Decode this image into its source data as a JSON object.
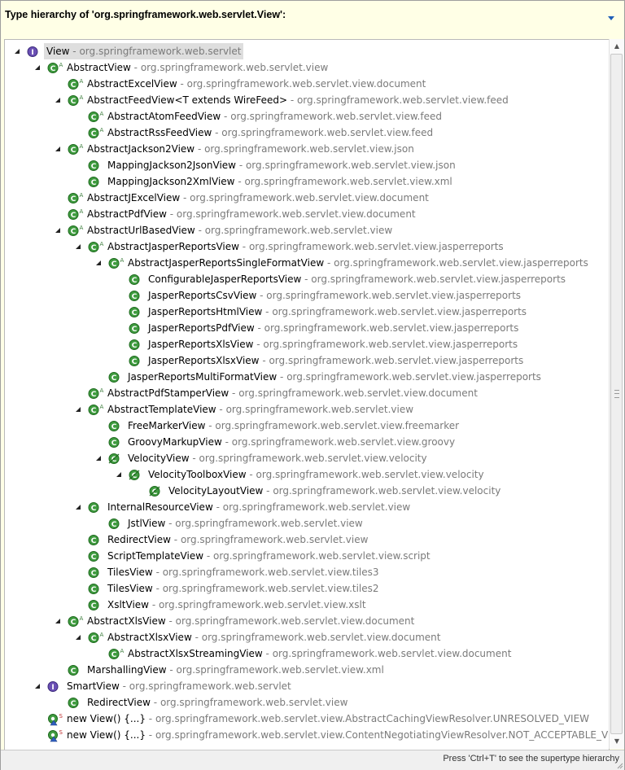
{
  "header": {
    "title": "Type hierarchy of 'org.springframework.web.servlet.View':",
    "menu_icon": "view-menu-chevron-icon"
  },
  "status": {
    "text": "Press 'Ctrl+T' to see the supertype hierarchy"
  },
  "colors": {
    "class_icon": "#3f9b3f",
    "interface_icon": "#6a4fb4",
    "selection": "#dedede",
    "package_text": "#7a7a7a",
    "panel_bg": "#ffffe6"
  },
  "tree": [
    {
      "depth": 0,
      "toggle": "expanded",
      "kind": "interface",
      "name": "View",
      "pkg": "org.springframework.web.servlet",
      "selected": true
    },
    {
      "depth": 1,
      "toggle": "expanded",
      "kind": "class",
      "mod": "A",
      "name": "AbstractView",
      "pkg": "org.springframework.web.servlet.view"
    },
    {
      "depth": 2,
      "toggle": "none",
      "kind": "class",
      "mod": "A",
      "name": "AbstractExcelView",
      "pkg": "org.springframework.web.servlet.view.document"
    },
    {
      "depth": 2,
      "toggle": "expanded",
      "kind": "class",
      "mod": "A",
      "name": "AbstractFeedView<T extends WireFeed>",
      "pkg": "org.springframework.web.servlet.view.feed"
    },
    {
      "depth": 3,
      "toggle": "none",
      "kind": "class",
      "mod": "A",
      "name": "AbstractAtomFeedView",
      "pkg": "org.springframework.web.servlet.view.feed"
    },
    {
      "depth": 3,
      "toggle": "none",
      "kind": "class",
      "mod": "A",
      "name": "AbstractRssFeedView",
      "pkg": "org.springframework.web.servlet.view.feed"
    },
    {
      "depth": 2,
      "toggle": "expanded",
      "kind": "class",
      "mod": "A",
      "name": "AbstractJackson2View",
      "pkg": "org.springframework.web.servlet.view.json"
    },
    {
      "depth": 3,
      "toggle": "none",
      "kind": "class",
      "name": "MappingJackson2JsonView",
      "pkg": "org.springframework.web.servlet.view.json"
    },
    {
      "depth": 3,
      "toggle": "none",
      "kind": "class",
      "name": "MappingJackson2XmlView",
      "pkg": "org.springframework.web.servlet.view.xml"
    },
    {
      "depth": 2,
      "toggle": "none",
      "kind": "class",
      "mod": "A",
      "name": "AbstractJExcelView",
      "pkg": "org.springframework.web.servlet.view.document"
    },
    {
      "depth": 2,
      "toggle": "none",
      "kind": "class",
      "mod": "A",
      "name": "AbstractPdfView",
      "pkg": "org.springframework.web.servlet.view.document"
    },
    {
      "depth": 2,
      "toggle": "expanded",
      "kind": "class",
      "mod": "A",
      "name": "AbstractUrlBasedView",
      "pkg": "org.springframework.web.servlet.view"
    },
    {
      "depth": 3,
      "toggle": "expanded",
      "kind": "class",
      "mod": "A",
      "name": "AbstractJasperReportsView",
      "pkg": "org.springframework.web.servlet.view.jasperreports"
    },
    {
      "depth": 4,
      "toggle": "expanded",
      "kind": "class",
      "mod": "A",
      "name": "AbstractJasperReportsSingleFormatView",
      "pkg": "org.springframework.web.servlet.view.jasperreports"
    },
    {
      "depth": 5,
      "toggle": "none",
      "kind": "class",
      "name": "ConfigurableJasperReportsView",
      "pkg": "org.springframework.web.servlet.view.jasperreports"
    },
    {
      "depth": 5,
      "toggle": "none",
      "kind": "class",
      "name": "JasperReportsCsvView",
      "pkg": "org.springframework.web.servlet.view.jasperreports"
    },
    {
      "depth": 5,
      "toggle": "none",
      "kind": "class",
      "name": "JasperReportsHtmlView",
      "pkg": "org.springframework.web.servlet.view.jasperreports"
    },
    {
      "depth": 5,
      "toggle": "none",
      "kind": "class",
      "name": "JasperReportsPdfView",
      "pkg": "org.springframework.web.servlet.view.jasperreports"
    },
    {
      "depth": 5,
      "toggle": "none",
      "kind": "class",
      "name": "JasperReportsXlsView",
      "pkg": "org.springframework.web.servlet.view.jasperreports"
    },
    {
      "depth": 5,
      "toggle": "none",
      "kind": "class",
      "name": "JasperReportsXlsxView",
      "pkg": "org.springframework.web.servlet.view.jasperreports"
    },
    {
      "depth": 4,
      "toggle": "none",
      "kind": "class",
      "name": "JasperReportsMultiFormatView",
      "pkg": "org.springframework.web.servlet.view.jasperreports"
    },
    {
      "depth": 3,
      "toggle": "none",
      "kind": "class",
      "mod": "A",
      "name": "AbstractPdfStamperView",
      "pkg": "org.springframework.web.servlet.view.document"
    },
    {
      "depth": 3,
      "toggle": "expanded",
      "kind": "class",
      "mod": "A",
      "name": "AbstractTemplateView",
      "pkg": "org.springframework.web.servlet.view"
    },
    {
      "depth": 4,
      "toggle": "none",
      "kind": "class",
      "name": "FreeMarkerView",
      "pkg": "org.springframework.web.servlet.view.freemarker"
    },
    {
      "depth": 4,
      "toggle": "none",
      "kind": "class",
      "name": "GroovyMarkupView",
      "pkg": "org.springframework.web.servlet.view.groovy"
    },
    {
      "depth": 4,
      "toggle": "expanded",
      "kind": "class",
      "deprecated": true,
      "name": "VelocityView",
      "pkg": "org.springframework.web.servlet.view.velocity"
    },
    {
      "depth": 5,
      "toggle": "expanded",
      "kind": "class",
      "deprecated": true,
      "name": "VelocityToolboxView",
      "pkg": "org.springframework.web.servlet.view.velocity"
    },
    {
      "depth": 6,
      "toggle": "none",
      "kind": "class",
      "deprecated": true,
      "name": "VelocityLayoutView",
      "pkg": "org.springframework.web.servlet.view.velocity"
    },
    {
      "depth": 3,
      "toggle": "expanded",
      "kind": "class",
      "name": "InternalResourceView",
      "pkg": "org.springframework.web.servlet.view"
    },
    {
      "depth": 4,
      "toggle": "none",
      "kind": "class",
      "name": "JstlView",
      "pkg": "org.springframework.web.servlet.view"
    },
    {
      "depth": 3,
      "toggle": "none",
      "kind": "class",
      "name": "RedirectView",
      "pkg": "org.springframework.web.servlet.view"
    },
    {
      "depth": 3,
      "toggle": "none",
      "kind": "class",
      "name": "ScriptTemplateView",
      "pkg": "org.springframework.web.servlet.view.script"
    },
    {
      "depth": 3,
      "toggle": "none",
      "kind": "class",
      "name": "TilesView",
      "pkg": "org.springframework.web.servlet.view.tiles3"
    },
    {
      "depth": 3,
      "toggle": "none",
      "kind": "class",
      "name": "TilesView",
      "pkg": "org.springframework.web.servlet.view.tiles2"
    },
    {
      "depth": 3,
      "toggle": "none",
      "kind": "class",
      "name": "XsltView",
      "pkg": "org.springframework.web.servlet.view.xslt"
    },
    {
      "depth": 2,
      "toggle": "expanded",
      "kind": "class",
      "mod": "A",
      "name": "AbstractXlsView",
      "pkg": "org.springframework.web.servlet.view.document"
    },
    {
      "depth": 3,
      "toggle": "expanded",
      "kind": "class",
      "mod": "A",
      "name": "AbstractXlsxView",
      "pkg": "org.springframework.web.servlet.view.document"
    },
    {
      "depth": 4,
      "toggle": "none",
      "kind": "class",
      "mod": "A",
      "name": "AbstractXlsxStreamingView",
      "pkg": "org.springframework.web.servlet.view.document"
    },
    {
      "depth": 2,
      "toggle": "none",
      "kind": "class",
      "name": "MarshallingView",
      "pkg": "org.springframework.web.servlet.view.xml"
    },
    {
      "depth": 1,
      "toggle": "expanded",
      "kind": "interface",
      "name": "SmartView",
      "pkg": "org.springframework.web.servlet"
    },
    {
      "depth": 2,
      "toggle": "none",
      "kind": "class",
      "name": "RedirectView",
      "pkg": "org.springframework.web.servlet.view"
    },
    {
      "depth": 1,
      "toggle": "none",
      "kind": "anon",
      "mod": "S",
      "name": "new View() {...}",
      "pkg": "org.springframework.web.servlet.view.AbstractCachingViewResolver.UNRESOLVED_VIEW"
    },
    {
      "depth": 1,
      "toggle": "none",
      "kind": "anon",
      "mod": "S",
      "name": "new View() {...}",
      "pkg": "org.springframework.web.servlet.view.ContentNegotiatingViewResolver.NOT_ACCEPTABLE_VIEW"
    }
  ]
}
